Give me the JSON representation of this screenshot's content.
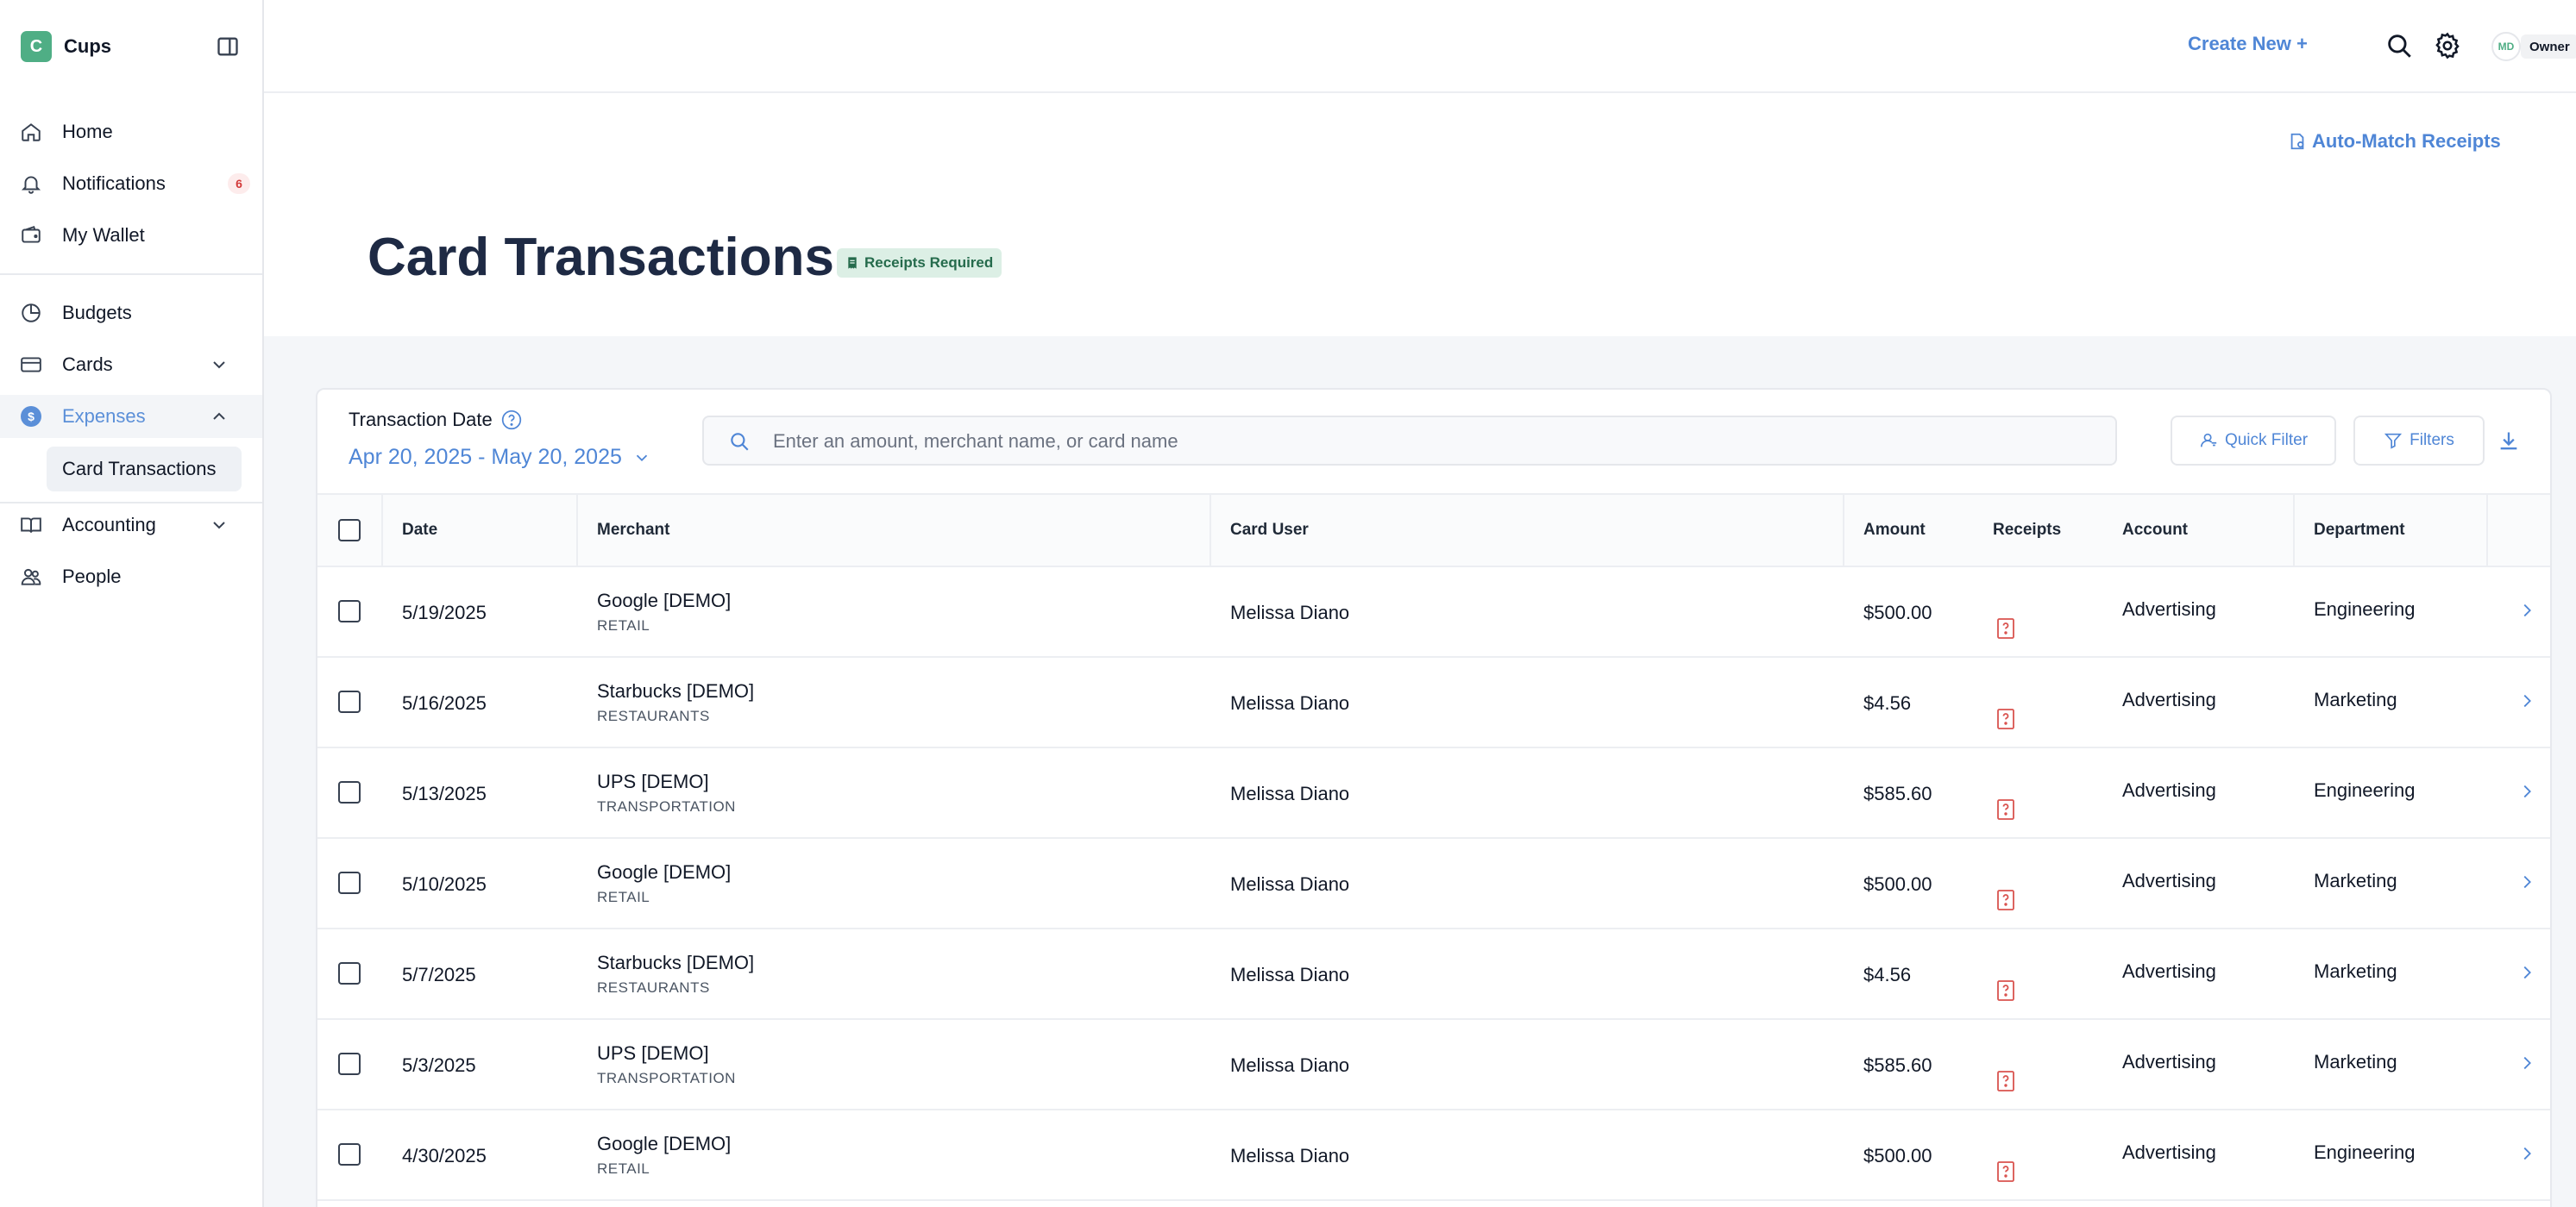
{
  "brand": {
    "initial": "C",
    "name": "Cups"
  },
  "sidebar": {
    "items": [
      {
        "label": "Home",
        "icon": "home-icon"
      },
      {
        "label": "Notifications",
        "icon": "bell-icon",
        "badge": "6"
      },
      {
        "label": "My Wallet",
        "icon": "wallet-icon"
      },
      {
        "label": "Budgets",
        "icon": "pie-chart-icon"
      },
      {
        "label": "Cards",
        "icon": "credit-card-icon"
      },
      {
        "label": "Expenses",
        "icon": "dollar-icon"
      },
      {
        "label": "Accounting",
        "icon": "book-icon"
      },
      {
        "label": "People",
        "icon": "people-icon"
      }
    ],
    "sub_item": "Card Transactions"
  },
  "topbar": {
    "create_new": "Create New +",
    "avatar_initials": "MD",
    "role": "Owner"
  },
  "header": {
    "auto_match": "Auto-Match Receipts",
    "title": "Card Transactions",
    "badge": "Receipts Required"
  },
  "toolbar": {
    "date_label": "Transaction Date",
    "date_range": "Apr 20, 2025 - May 20, 2025",
    "search_placeholder": "Enter an amount, merchant name, or card name",
    "quick_filter": "Quick Filter",
    "filters": "Filters"
  },
  "table": {
    "columns": [
      "Date",
      "Merchant",
      "Card User",
      "Amount",
      "Receipts",
      "Account",
      "Department"
    ],
    "rows": [
      {
        "date": "5/19/2025",
        "merchant": "Google [DEMO]",
        "category": "RETAIL",
        "user": "Melissa Diano",
        "amount": "$500.00",
        "account": "Advertising",
        "department": "Engineering"
      },
      {
        "date": "5/16/2025",
        "merchant": "Starbucks [DEMO]",
        "category": "RESTAURANTS",
        "user": "Melissa Diano",
        "amount": "$4.56",
        "account": "Advertising",
        "department": "Marketing"
      },
      {
        "date": "5/13/2025",
        "merchant": "UPS [DEMO]",
        "category": "TRANSPORTATION",
        "user": "Melissa Diano",
        "amount": "$585.60",
        "account": "Advertising",
        "department": "Engineering"
      },
      {
        "date": "5/10/2025",
        "merchant": "Google [DEMO]",
        "category": "RETAIL",
        "user": "Melissa Diano",
        "amount": "$500.00",
        "account": "Advertising",
        "department": "Marketing"
      },
      {
        "date": "5/7/2025",
        "merchant": "Starbucks [DEMO]",
        "category": "RESTAURANTS",
        "user": "Melissa Diano",
        "amount": "$4.56",
        "account": "Advertising",
        "department": "Marketing"
      },
      {
        "date": "5/3/2025",
        "merchant": "UPS [DEMO]",
        "category": "TRANSPORTATION",
        "user": "Melissa Diano",
        "amount": "$585.60",
        "account": "Advertising",
        "department": "Marketing"
      },
      {
        "date": "4/30/2025",
        "merchant": "Google [DEMO]",
        "category": "RETAIL",
        "user": "Melissa Diano",
        "amount": "$500.00",
        "account": "Advertising",
        "department": "Engineering"
      }
    ]
  },
  "colors": {
    "accent": "#4f86d6",
    "brand": "#4fae85",
    "receipt_missing": "#d9534f",
    "badge_bg": "#dcefe5"
  }
}
